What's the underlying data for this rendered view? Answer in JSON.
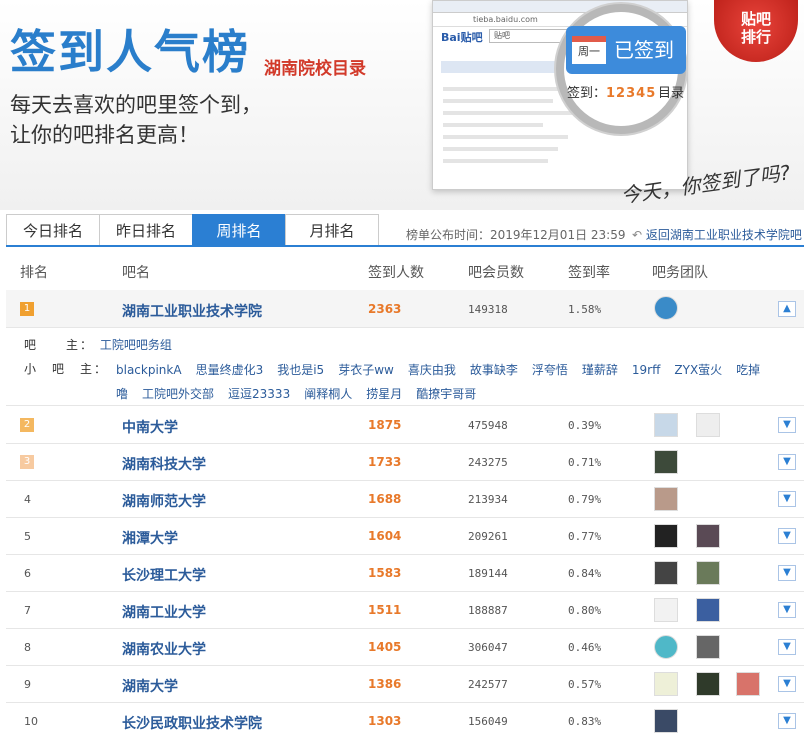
{
  "header": {
    "title": "签到人气榜",
    "subtitle": "湖南院校目录",
    "slogan_line1": "每天去喜欢的吧里签个到，",
    "slogan_line2": "让你的吧排名更高！",
    "sign_button": "已签到",
    "calendar_label": "周一",
    "sign_count_label": "签到：",
    "sign_count_value": "12345",
    "catalog_label": "目录",
    "seal_line1": "贴吧",
    "seal_line2": "排行",
    "handwriting": "今天，你签到了吗?",
    "shot_url": "tieba.baidu.com",
    "shot_logo": "Bai贴吧",
    "shot_search": "贴吧"
  },
  "tabs": [
    {
      "label": "今日排名",
      "active": false
    },
    {
      "label": "昨日排名",
      "active": false
    },
    {
      "label": "周排名",
      "active": true
    },
    {
      "label": "月排名",
      "active": false
    }
  ],
  "pubtime": "榜单公布时间：2019年12月01日 23:59",
  "backlink": "返回湖南工业职业技术学院吧",
  "columns": {
    "rank": "排名",
    "name": "吧名",
    "sign": "签到人数",
    "members": "吧会员数",
    "rate": "签到率",
    "team": "吧务团队"
  },
  "detail": {
    "manager_label": "吧　　主：",
    "manager": "工院吧吧务组",
    "sub_label": "小　吧　主：",
    "sub_managers": [
      "blackpinkA",
      "思量终虚化3",
      "我也是i5",
      "芽衣子ww",
      "喜庆由我",
      "故事缺李",
      "浮夸悟",
      "瑾薪辞",
      "19rff",
      "ZYX萤火",
      "吃掉",
      "噜",
      "工院吧外交部",
      "逗逗23333",
      "阐释桐人",
      "捞星月",
      "酷撩宇哥哥"
    ]
  },
  "rows": [
    {
      "rank": "1",
      "name": "湖南工业职业技术学院",
      "sign": "2363",
      "members": "149318",
      "rate": "1.58%"
    },
    {
      "rank": "2",
      "name": "中南大学",
      "sign": "1875",
      "members": "475948",
      "rate": "0.39%"
    },
    {
      "rank": "3",
      "name": "湖南科技大学",
      "sign": "1733",
      "members": "243275",
      "rate": "0.71%"
    },
    {
      "rank": "4",
      "name": "湖南师范大学",
      "sign": "1688",
      "members": "213934",
      "rate": "0.79%"
    },
    {
      "rank": "5",
      "name": "湘潭大学",
      "sign": "1604",
      "members": "209261",
      "rate": "0.77%"
    },
    {
      "rank": "6",
      "name": "长沙理工大学",
      "sign": "1583",
      "members": "189144",
      "rate": "0.84%"
    },
    {
      "rank": "7",
      "name": "湖南工业大学",
      "sign": "1511",
      "members": "188887",
      "rate": "0.80%"
    },
    {
      "rank": "8",
      "name": "湖南农业大学",
      "sign": "1405",
      "members": "306047",
      "rate": "0.46%"
    },
    {
      "rank": "9",
      "name": "湖南大学",
      "sign": "1386",
      "members": "242577",
      "rate": "0.57%"
    },
    {
      "rank": "10",
      "name": "长沙民政职业技术学院",
      "sign": "1303",
      "members": "156049",
      "rate": "0.83%"
    }
  ],
  "colors": {
    "accent": "#2b7fd3",
    "sign": "#e8792a",
    "medal_gold": "#f0a030",
    "medal_silver": "#f4b860",
    "medal_bronze": "#f7caa0"
  },
  "icons": {
    "back": "back-arrow-icon",
    "toggle": "chevron-down-icon",
    "calendar": "calendar-icon"
  }
}
